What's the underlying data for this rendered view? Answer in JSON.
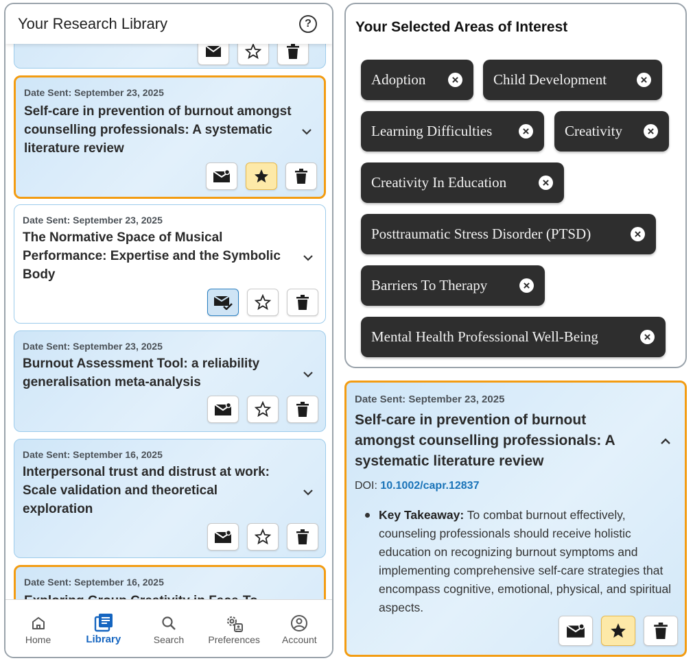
{
  "library": {
    "title": "Your Research Library",
    "cards": [
      {
        "date": "Date Sent: September 23, 2025",
        "title": "Self-care in prevention of burnout amongst counselling professionals: A systematic literature review",
        "starred": true
      },
      {
        "date": "Date Sent: September 23, 2025",
        "title": "The Normative Space of Musical Performance: Expertise and the Symbolic Body",
        "sent": true
      },
      {
        "date": "Date Sent: September 23, 2025",
        "title": "Burnout Assessment Tool: a reliability generalisation meta-analysis"
      },
      {
        "date": "Date Sent: September 16, 2025",
        "title": "Interpersonal trust and distrust at work: Scale validation and theoretical exploration"
      },
      {
        "date": "Date Sent: September 16, 2025",
        "title": "Exploring Group Creativity in Face-To-"
      }
    ],
    "nav": [
      {
        "label": "Home",
        "icon": "home-icon"
      },
      {
        "label": "Library",
        "icon": "library-icon",
        "active": true
      },
      {
        "label": "Search",
        "icon": "search-icon"
      },
      {
        "label": "Preferences",
        "icon": "preferences-icon"
      },
      {
        "label": "Account",
        "icon": "account-icon"
      }
    ]
  },
  "interests": {
    "title": "Your Selected Areas of Interest",
    "chips": [
      "Adoption",
      "Child Development",
      "Learning Difficulties",
      "Creativity",
      "Creativity In Education",
      "Posttraumatic Stress Disorder (PTSD)",
      "Barriers To Therapy",
      "Mental Health Professional Well-Being"
    ]
  },
  "expanded": {
    "date": "Date Sent: September 23, 2025",
    "title": "Self-care in prevention of burnout amongst counselling professionals: A systematic literature review",
    "doi_label": "DOI:",
    "doi_value": "10.1002/capr.12837",
    "takeaway_label": "Key Takeaway:",
    "takeaway_text": "To combat burnout effectively, counseling professionals should receive holistic education on recognizing burnout symptoms and implementing comprehensive self-care strategies that encompass cognitive, emotional, physical, and spiritual aspects."
  },
  "colors": {
    "accent": "#1565c0",
    "highlight_border": "#f39c12",
    "chip_bg": "#2e2e2e",
    "star_bg": "#fde9a8"
  }
}
